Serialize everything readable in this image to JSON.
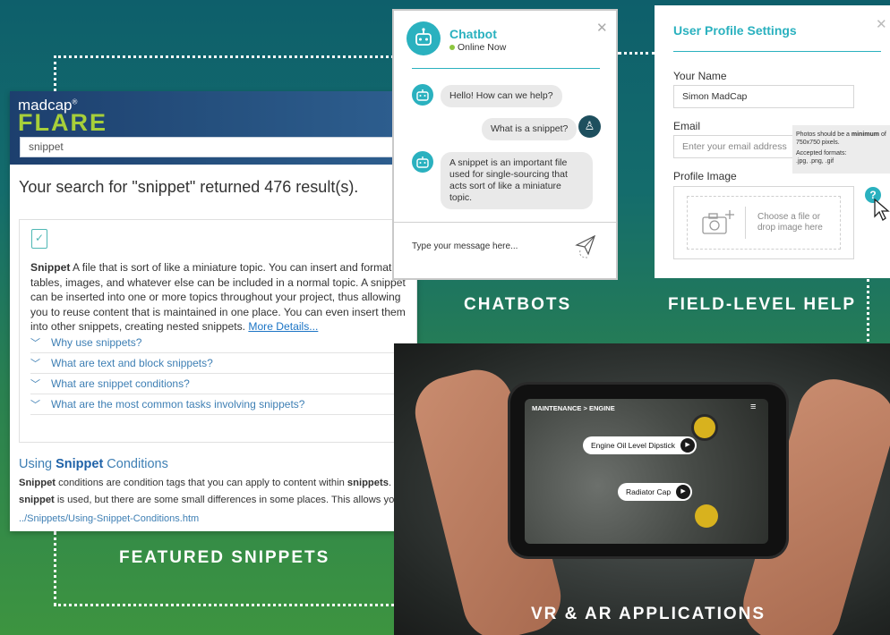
{
  "flare": {
    "brand_top": "madcap",
    "brand_mark": "®",
    "brand_main": "FLARE",
    "search_value": "snippet",
    "result_title": "Your search for \"snippet\" returned 476 result(s).",
    "definition_term": "Snippet",
    "definition_text": " A file that is sort of like a miniature topic. You can insert and format tables, images, and whatever else can be included in a normal topic. A snippet can be inserted into one or more topics throughout your project, thus allowing you to reuse content that is maintained in one place. You can even insert them into other snippets, creating nested snippets. ",
    "more_details": "More Details...",
    "faqs": [
      "Why use snippets?",
      "What are text and block snippets?",
      "What are snippet conditions?",
      "What are the most common tasks involving snippets?"
    ],
    "result2_title_pre": "Using ",
    "result2_title_bold": "Snippet",
    "result2_title_post": " Conditions",
    "result2_line1_b1": "Snippet",
    "result2_line1_t1": " conditions are condition tags that you can apply to content within ",
    "result2_line1_b2": "snippets",
    "result2_line1_t2": ".",
    "result2_line2_b1": "snippet",
    "result2_line2_t1": " is used, but there are some small differences in some places. This allows yo",
    "result2_path": "../Snippets/Using-Snippet-Conditions.htm"
  },
  "chatbot": {
    "title": "Chatbot",
    "status": "Online Now",
    "msg1": "Hello! How can we help?",
    "msg2": "What is a snippet?",
    "msg3": "A snippet is an important file used for single-sourcing that acts sort of like a miniature topic.",
    "input_placeholder": "Type your message here..."
  },
  "profile": {
    "title": "User Profile Settings",
    "name_label": "Your Name",
    "name_value": "Simon MadCap",
    "email_label": "Email",
    "email_placeholder": "Enter your email address",
    "image_label": "Profile Image",
    "drop_text": "Choose a file or drop image here",
    "tooltip_line1_pre": "Photos should be a ",
    "tooltip_line1_bold": "minimum",
    "tooltip_line1_post": " of 750x750 pixels.",
    "tooltip_line2": "Accepted formats:",
    "tooltip_line3": ".jpg, .png, .gif",
    "help_glyph": "?"
  },
  "ar": {
    "breadcrumb": "MAINTENANCE > ENGINE",
    "pin1": "Engine Oil Level Dipstick",
    "pin2": "Radiator Cap"
  },
  "labels": {
    "chatbots": "CHATBOTS",
    "field_help": "FIELD-LEVEL HELP",
    "featured": "FEATURED SNIPPETS",
    "vrar": "VR & AR APPLICATIONS"
  },
  "colors": {
    "teal": "#2ab1bf",
    "flare_green": "#a7cf3a",
    "link_blue": "#3e7fb4",
    "online_green": "#8dc63f"
  }
}
